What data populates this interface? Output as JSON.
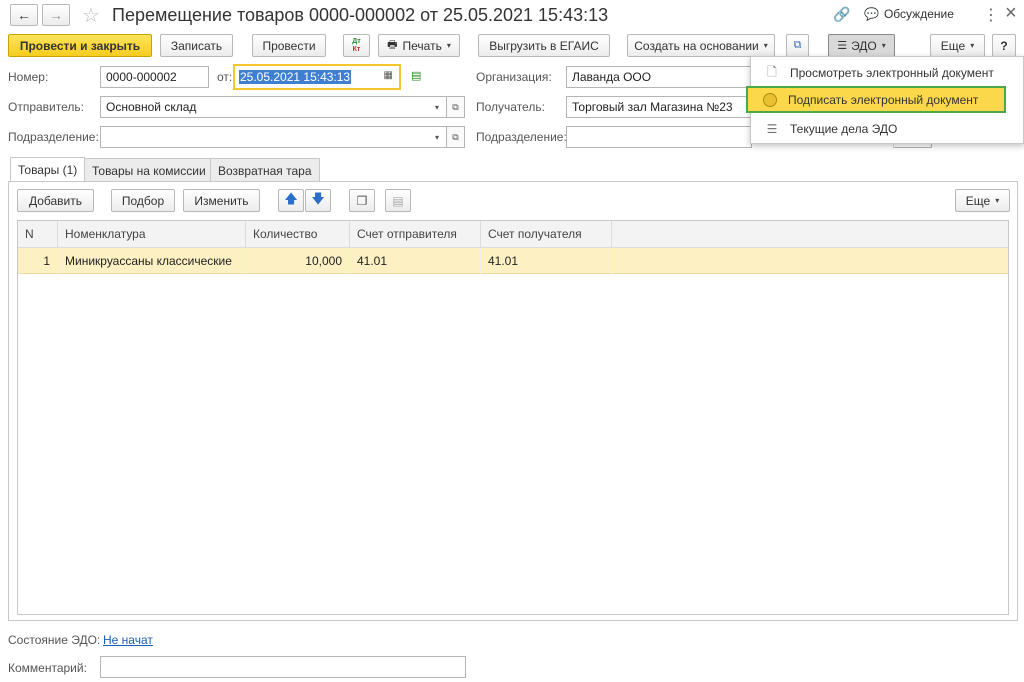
{
  "window": {
    "title": "Перемещение товаров 0000-000002 от 25.05.2021 15:43:13",
    "discussion_label": "Обсуждение",
    "more_icon": "⋮",
    "close_icon": "×"
  },
  "toolbar": {
    "post_close": "Провести и закрыть",
    "save": "Записать",
    "post": "Провести",
    "dtkt_top": "Дт",
    "dtkt_bottom": "Кт",
    "print": "Печать",
    "egais": "Выгрузить в ЕГАИС",
    "create_based": "Создать на основании",
    "edo": "ЭДО",
    "more": "Еще",
    "help": "?"
  },
  "form": {
    "number_label": "Номер:",
    "number_value": "0000-000002",
    "date_label": "от:",
    "date_value": "25.05.2021 15:43:13",
    "org_label": "Организация:",
    "org_value": "Лаванда ООО",
    "sender_label": "Отправитель:",
    "sender_value": "Основной склад",
    "recipient_label": "Получатель:",
    "recipient_value": "Торговый зал Магазина №23",
    "subdiv_label": "Подразделение:",
    "subdiv_value": "",
    "subdiv2_label": "Подразделение:",
    "subdiv2_value": ""
  },
  "tabs": [
    {
      "label": "Товары (1)",
      "active": true
    },
    {
      "label": "Товары на комиссии",
      "active": false
    },
    {
      "label": "Возвратная тара",
      "active": false
    }
  ],
  "table_toolbar": {
    "add": "Добавить",
    "pick": "Подбор",
    "edit": "Изменить",
    "more": "Еще"
  },
  "table": {
    "columns": [
      "N",
      "Номенклатура",
      "Количество",
      "Счет отправителя",
      "Счет получателя"
    ],
    "rows": [
      {
        "n": "1",
        "item": "Миникруассаны классические",
        "qty": "10,000",
        "acc_from": "41.01",
        "acc_to": "41.01"
      }
    ]
  },
  "footer": {
    "edo_state_label": "Состояние ЭДО:",
    "edo_state_value": "Не начат",
    "comment_label": "Комментарий:",
    "comment_value": ""
  },
  "edo_menu": {
    "items": [
      {
        "label": "Просмотреть электронный документ",
        "icon": "document-icon",
        "highlighted": false
      },
      {
        "label": "Подписать электронный документ",
        "icon": "signature-icon",
        "highlighted": true
      },
      {
        "label": "Текущие дела ЭДО",
        "icon": "tasks-icon",
        "highlighted": false
      }
    ]
  },
  "colors": {
    "primary_button": "#f5cd1f",
    "selected_row": "#fdf1c4",
    "menu_highlight": "#fbd84a",
    "menu_highlight_border": "#4aa84a",
    "link": "#1b5cb5"
  }
}
